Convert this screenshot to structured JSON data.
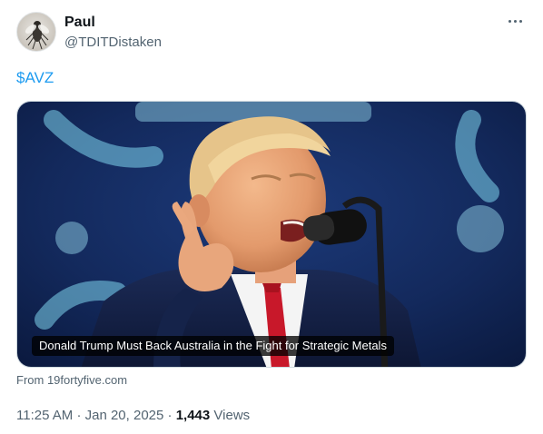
{
  "author": {
    "display_name": "Paul",
    "handle": "@TDITDistaken",
    "avatar_icon": "fly-avatar"
  },
  "tweet": {
    "text": "$AVZ"
  },
  "card": {
    "headline": "Donald Trump Must Back Australia in the Fight for Strategic Metals",
    "source": "From 19fortyfive.com"
  },
  "meta": {
    "time": "11:25 AM",
    "separator": "·",
    "date": "Jan 20, 2025",
    "views_count": "1,443",
    "views_label": "Views"
  },
  "colors": {
    "accent": "#1d9bf0",
    "secondary_text": "#536471",
    "primary_text": "#0f1419"
  }
}
